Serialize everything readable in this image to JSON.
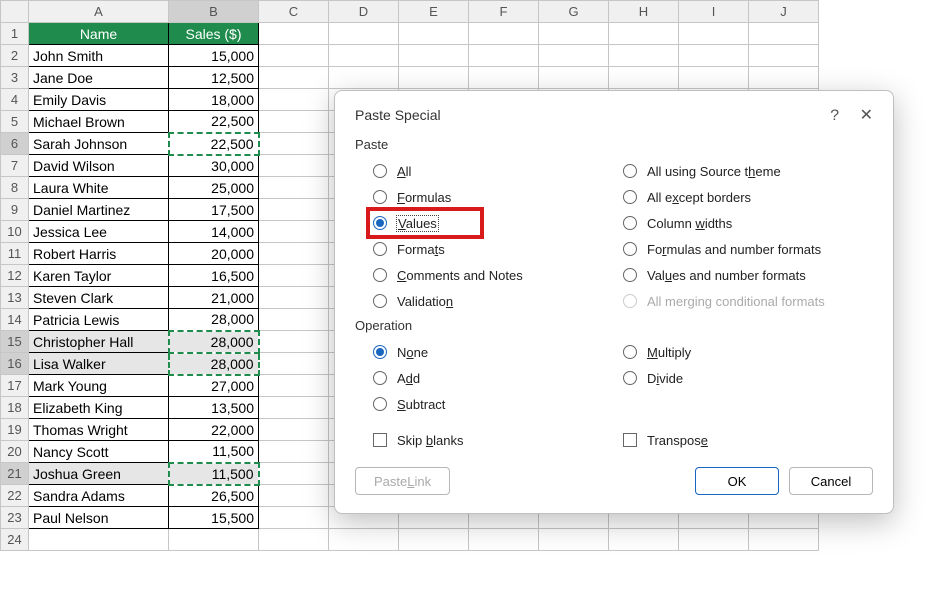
{
  "columns": [
    "A",
    "B",
    "C",
    "D",
    "E",
    "F",
    "G",
    "H",
    "I",
    "J"
  ],
  "header": {
    "name": "Name",
    "sales": "Sales ($)"
  },
  "rows": [
    {
      "n": 1
    },
    {
      "n": 2,
      "name": "John Smith",
      "sales": "15,000"
    },
    {
      "n": 3,
      "name": "Jane Doe",
      "sales": "12,500"
    },
    {
      "n": 4,
      "name": "Emily Davis",
      "sales": "18,000"
    },
    {
      "n": 5,
      "name": "Michael Brown",
      "sales": "22,500"
    },
    {
      "n": 6,
      "name": "Sarah Johnson",
      "sales": "22,500",
      "marching": true
    },
    {
      "n": 7,
      "name": "David Wilson",
      "sales": "30,000"
    },
    {
      "n": 8,
      "name": "Laura White",
      "sales": "25,000"
    },
    {
      "n": 9,
      "name": "Daniel Martinez",
      "sales": "17,500"
    },
    {
      "n": 10,
      "name": "Jessica Lee",
      "sales": "14,000"
    },
    {
      "n": 11,
      "name": "Robert Harris",
      "sales": "20,000"
    },
    {
      "n": 12,
      "name": "Karen Taylor",
      "sales": "16,500"
    },
    {
      "n": 13,
      "name": "Steven Clark",
      "sales": "21,000"
    },
    {
      "n": 14,
      "name": "Patricia Lewis",
      "sales": "28,000"
    },
    {
      "n": 15,
      "name": "Christopher Hall",
      "sales": "28,000",
      "dup": true,
      "marching": true
    },
    {
      "n": 16,
      "name": "Lisa Walker",
      "sales": "28,000",
      "dup": true,
      "marching": true
    },
    {
      "n": 17,
      "name": "Mark Young",
      "sales": "27,000"
    },
    {
      "n": 18,
      "name": "Elizabeth King",
      "sales": "13,500"
    },
    {
      "n": 19,
      "name": "Thomas Wright",
      "sales": "22,000"
    },
    {
      "n": 20,
      "name": "Nancy Scott",
      "sales": "11,500"
    },
    {
      "n": 21,
      "name": "Joshua Green",
      "sales": "11,500",
      "dup": true,
      "marching": true
    },
    {
      "n": 22,
      "name": "Sandra Adams",
      "sales": "26,500"
    },
    {
      "n": 23,
      "name": "Paul Nelson",
      "sales": "15,500"
    },
    {
      "n": 24
    }
  ],
  "dialog": {
    "title": "Paste Special",
    "paste_label": "Paste",
    "operation_label": "Operation",
    "paste_left": {
      "all": "All",
      "formulas": "Formulas",
      "values": "Values",
      "formats": "Formats",
      "comments": "Comments and Notes",
      "validation": "Validation"
    },
    "paste_right": {
      "source_theme": "All using Source theme",
      "except_borders": "All except borders",
      "col_widths": "Column widths",
      "formulas_num": "Formulas and number formats",
      "values_num": "Values and number formats",
      "merging": "All merging conditional formats"
    },
    "operation": {
      "none": "None",
      "add": "Add",
      "subtract": "Subtract",
      "multiply": "Multiply",
      "divide": "Divide"
    },
    "skip_blanks": "Skip blanks",
    "transpose": "Transpose",
    "paste_link": "Paste Link",
    "ok": "OK",
    "cancel": "Cancel"
  }
}
